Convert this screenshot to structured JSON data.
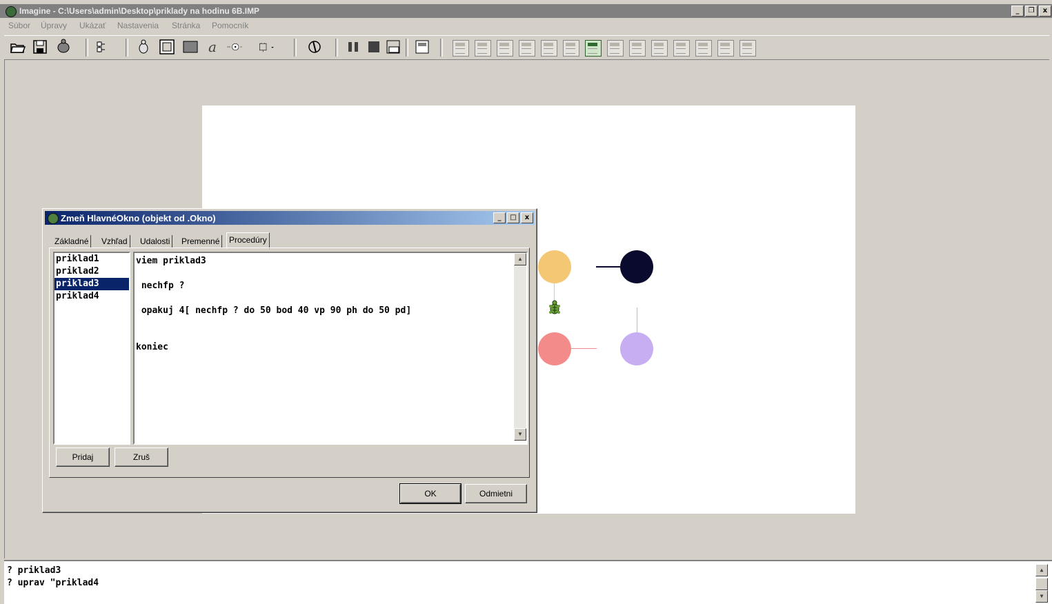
{
  "app": {
    "title": "Imagine - C:\\Users\\admin\\Desktop\\priklady na hodinu 6B.IMP",
    "window_buttons": [
      "_",
      "ř",
      "x"
    ]
  },
  "menu": [
    "Súbor",
    "Úpravy",
    "Ukázať",
    "Nastavenia",
    "Stránka",
    "Pomocník"
  ],
  "toolbar": {
    "icons": [
      "open-icon",
      "save-icon",
      "turtle-icon",
      "tree-icon",
      "new-turtle-icon",
      "new-pane-icon",
      "new-panel-icon",
      "text-icon",
      "slider-icon",
      "button-icon",
      "run-icon",
      "pause-icon",
      "stop-icon",
      "run-slot-icon",
      "page-icon"
    ],
    "page_buttons": 14,
    "active_page_index": 6
  },
  "dialog": {
    "title": "Zmeň HlavnéOkno (objekt od .Okno)",
    "tabs": [
      "Základné",
      "Vzhľad",
      "Udalosti",
      "Premenné",
      "Procedúry"
    ],
    "active_tab": "Procedúry",
    "procedures": [
      "priklad1",
      "priklad2",
      "priklad3",
      "priklad4"
    ],
    "selected_procedure": "priklad3",
    "code_lines": [
      "viem priklad3",
      " nechfp ?",
      " opakuj 4[ nechfp ? do 50 bod 40 vp 90 ph do 50 pd]",
      "koniec"
    ],
    "buttons": {
      "add": "Pridaj",
      "remove": "Zruš",
      "ok": "OK",
      "cancel": "Odmietni"
    }
  },
  "canvas": {
    "colors": {
      "circle1": "#f4c774",
      "circle2": "#0a0a2e",
      "circle3": "#f48b8b",
      "circle4": "#c7adf2"
    }
  },
  "command_panel": {
    "lines": [
      "? priklad3",
      "? uprav \"priklad4"
    ]
  }
}
